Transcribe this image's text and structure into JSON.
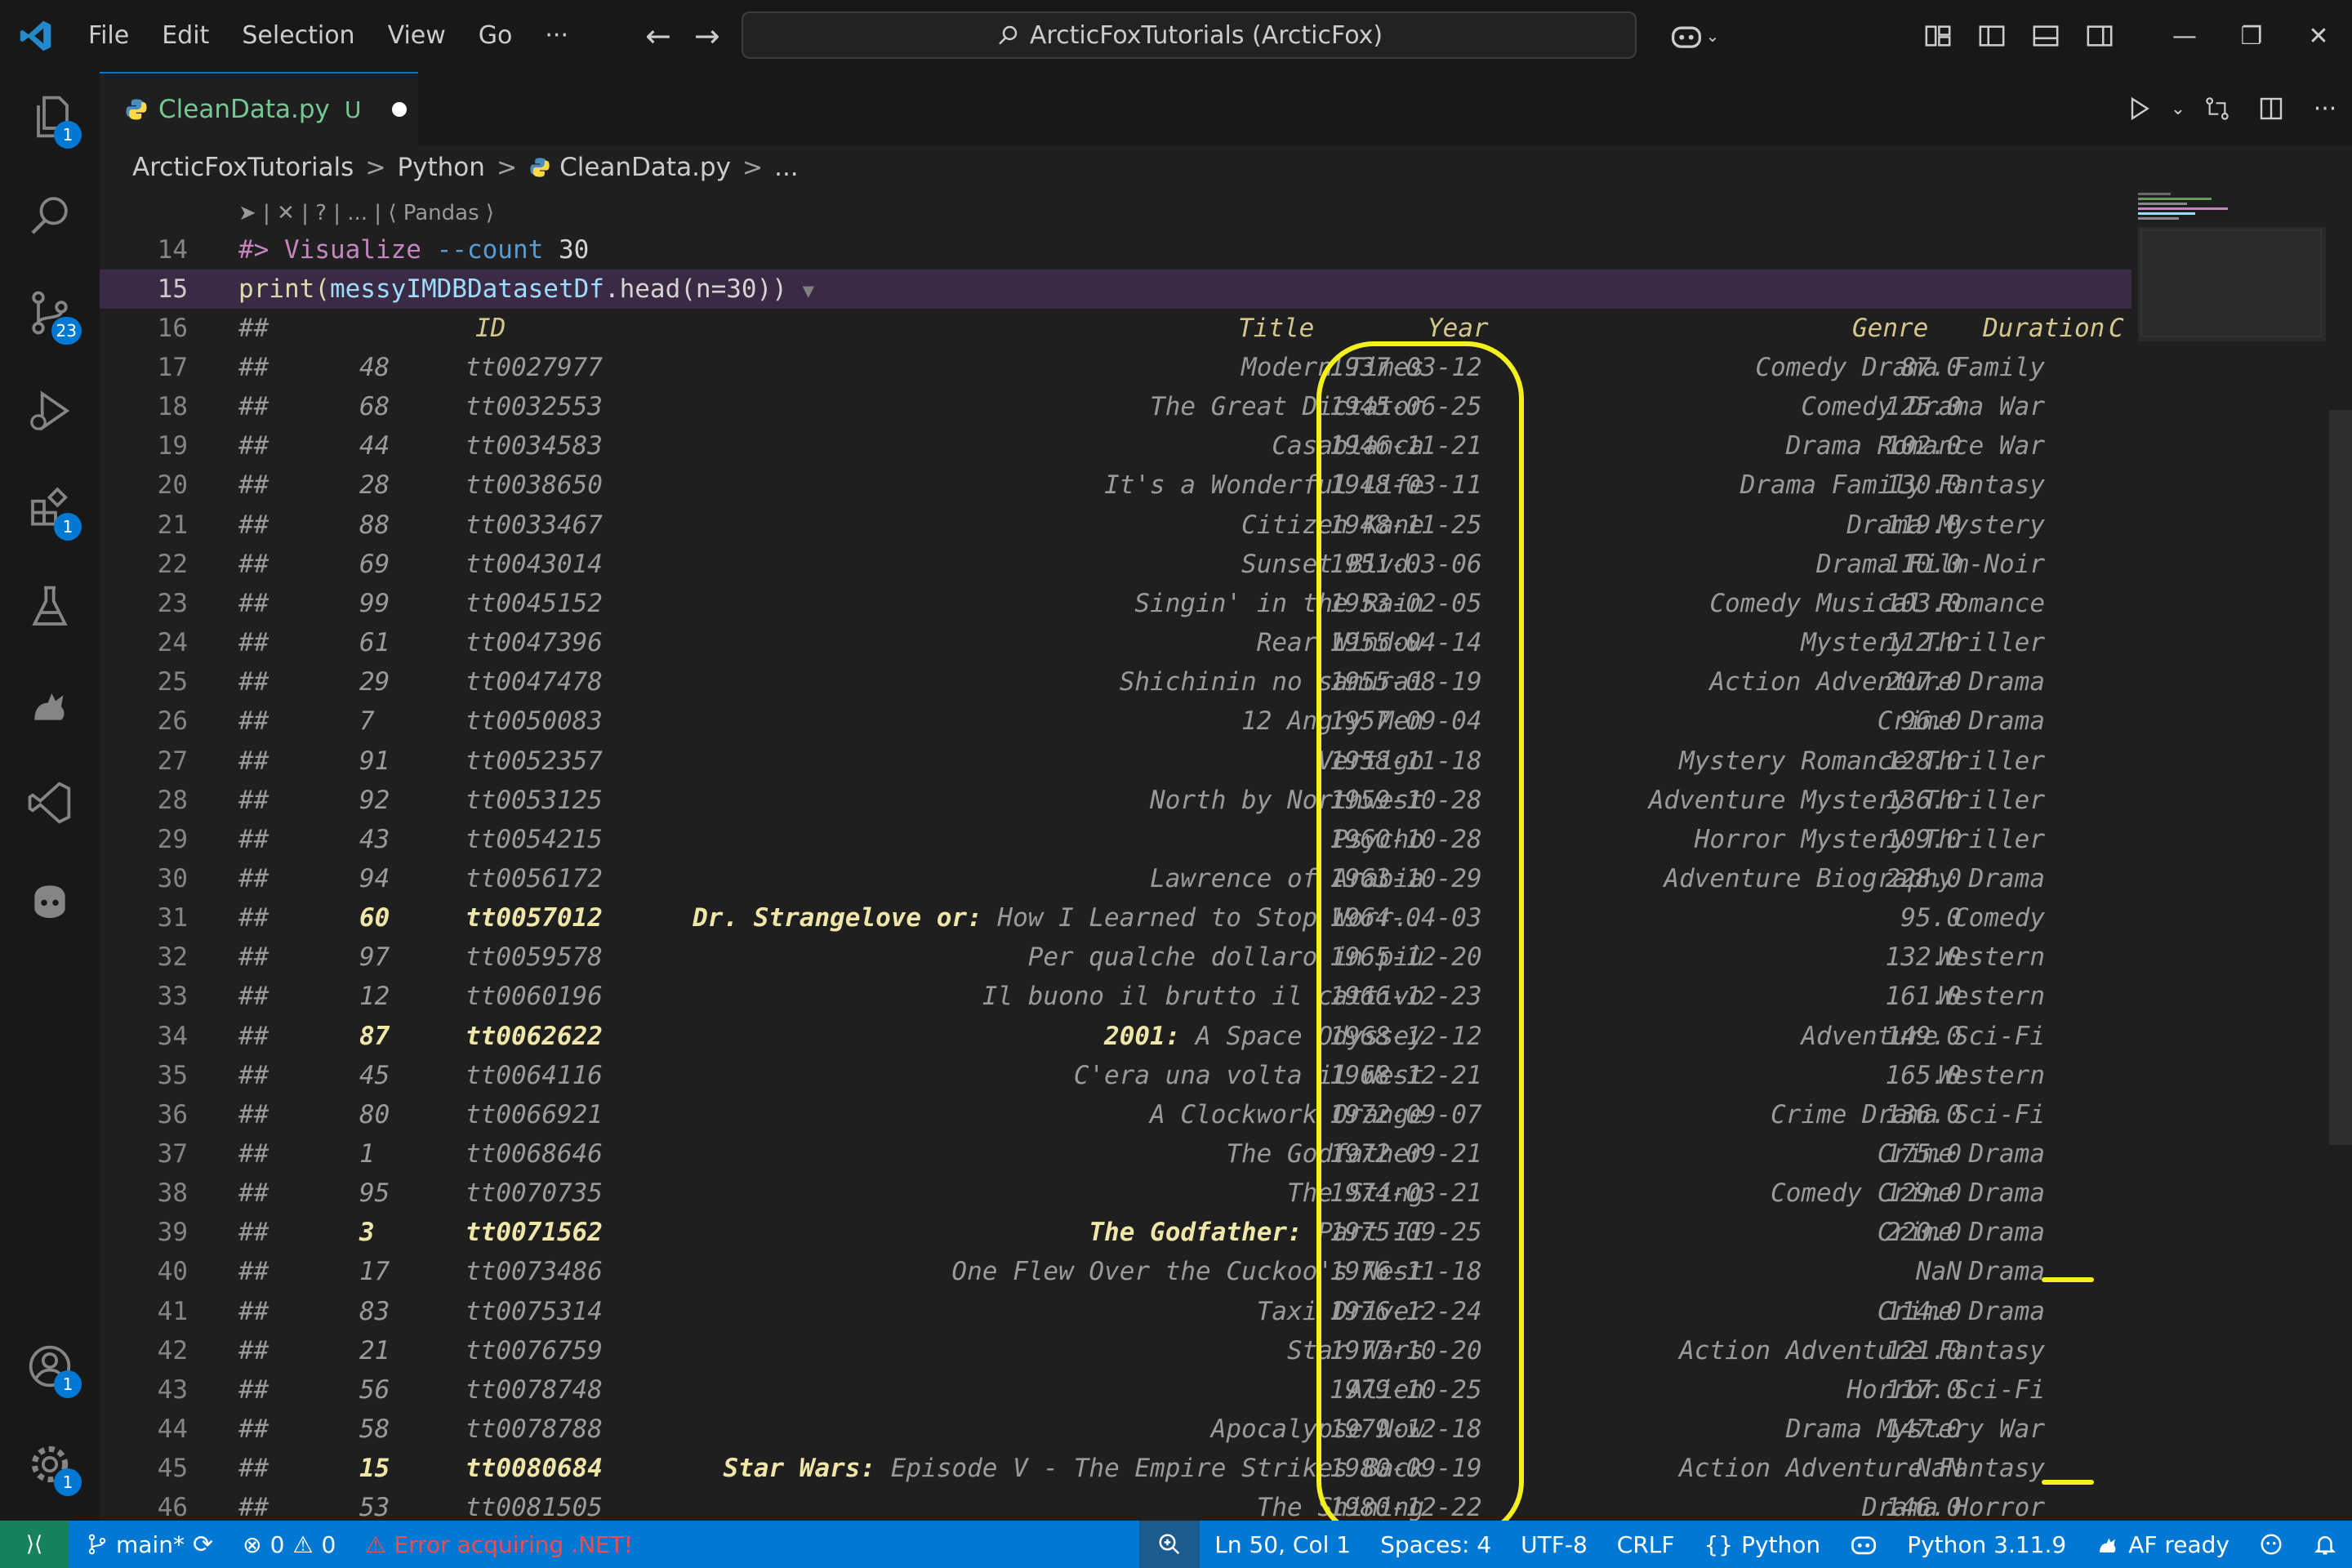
{
  "menu": {
    "items": [
      "File",
      "Edit",
      "Selection",
      "View",
      "Go"
    ],
    "more": "···"
  },
  "command_center": {
    "text": "ArcticFoxTutorials (ArcticFox)"
  },
  "activity_badges": {
    "explorer": "1",
    "source_control": "23",
    "extensions": "1",
    "accounts": "1",
    "manage": "1"
  },
  "tab": {
    "name": "CleanData.py",
    "status": "U"
  },
  "breadcrumb": {
    "folder1": "ArcticFoxTutorials",
    "folder2": "Python",
    "file": "CleanData.py",
    "more": "..."
  },
  "codelens": "➤ | ✕ | ? | ... | ⟨ Pandas ⟩",
  "editor": {
    "line14": {
      "num": "14",
      "hash": "#>",
      "cmd": " Visualize",
      "flag": " --count",
      "arg": " 30"
    },
    "line15": {
      "num": "15",
      "text_pre": "print(",
      "ident": "messyIMDBDatasetDf",
      "text_post": ".head(n=30))",
      "fold": "▼"
    },
    "header": {
      "num": "16",
      "hash": "##",
      "id": "ID",
      "title": "Title",
      "year": "Year",
      "genre": "Genre",
      "duration": "Duration",
      "cut": "C"
    },
    "rows": [
      {
        "num": "17",
        "idx": "48",
        "id": "tt0027977",
        "title": "Modern Times",
        "year": "1937-03-12",
        "genre": "Comedy Drama Family",
        "dur": "87.0"
      },
      {
        "num": "18",
        "idx": "68",
        "id": "tt0032553",
        "title": "The Great Dictator",
        "year": "1945-06-25",
        "genre": "Comedy Drama War",
        "dur": "125.0"
      },
      {
        "num": "19",
        "idx": "44",
        "id": "tt0034583",
        "title": "Casablanca",
        "year": "1946-11-21",
        "genre": "Drama Romance War",
        "dur": "102.0"
      },
      {
        "num": "20",
        "idx": "28",
        "id": "tt0038650",
        "title": "It's a Wonderful Life",
        "year": "1948-03-11",
        "genre": "Drama Family Fantasy",
        "dur": "130.0"
      },
      {
        "num": "21",
        "idx": "88",
        "id": "tt0033467",
        "title": "Citizen Kane",
        "year": "1948-11-25",
        "genre": "Drama Mystery",
        "dur": "119.0"
      },
      {
        "num": "22",
        "idx": "69",
        "id": "tt0043014",
        "title": "Sunset Blvd.",
        "year": "1951-03-06",
        "genre": "Drama Film-Noir",
        "dur": "110.0"
      },
      {
        "num": "23",
        "idx": "99",
        "id": "tt0045152",
        "title": "Singin' in the Rain",
        "year": "1953-02-05",
        "genre": "Comedy Musical Romance",
        "dur": "103.0"
      },
      {
        "num": "24",
        "idx": "61",
        "id": "tt0047396",
        "title": "Rear Window",
        "year": "1955-04-14",
        "genre": "Mystery Thriller",
        "dur": "112.0"
      },
      {
        "num": "25",
        "idx": "29",
        "id": "tt0047478",
        "title": "Shichinin no samurai",
        "year": "1955-08-19",
        "genre": "Action Adventure Drama",
        "dur": "207.0"
      },
      {
        "num": "26",
        "idx": "7",
        "id": "tt0050083",
        "title": "12 Angry Men",
        "year": "1957-09-04",
        "genre": "Crime Drama",
        "dur": "96.0"
      },
      {
        "num": "27",
        "idx": "91",
        "id": "tt0052357",
        "title": "Vertigo",
        "year": "1958-11-18",
        "genre": "Mystery Romance Thriller",
        "dur": "128.0"
      },
      {
        "num": "28",
        "idx": "92",
        "id": "tt0053125",
        "title": "North by Northwest",
        "year": "1959-10-28",
        "genre": "Adventure Mystery Thriller",
        "dur": "136.0"
      },
      {
        "num": "29",
        "idx": "43",
        "id": "tt0054215",
        "title": "Psycho",
        "year": "1960-10-28",
        "genre": "Horror Mystery Thriller",
        "dur": "109.0"
      },
      {
        "num": "30",
        "idx": "94",
        "id": "tt0056172",
        "title": "Lawrence of Arabia",
        "year": "1963-10-29",
        "genre": "Adventure Biography Drama",
        "dur": "228.0"
      },
      {
        "num": "31",
        "idx": "60",
        "id": "tt0057012",
        "title_bold": "Dr. Strangelove or:",
        "title": " How I Learned to Stop Worr..",
        "year": "1964-04-03",
        "genre": "Comedy",
        "dur": "95.0",
        "bold": true
      },
      {
        "num": "32",
        "idx": "97",
        "id": "tt0059578",
        "title": "Per qualche dollaro in più",
        "year": "1965-12-20",
        "genre": "Western",
        "dur": "132.0"
      },
      {
        "num": "33",
        "idx": "12",
        "id": "tt0060196",
        "title": "Il buono il brutto il cattivo",
        "year": "1966-12-23",
        "genre": "Western",
        "dur": "161.0"
      },
      {
        "num": "34",
        "idx": "87",
        "id": "tt0062622",
        "title_bold": "2001:",
        "title": " A Space Odyssey",
        "year": "1968-12-12",
        "genre": "Adventure Sci-Fi",
        "dur": "149.0",
        "bold": true
      },
      {
        "num": "35",
        "idx": "45",
        "id": "tt0064116",
        "title": "C'era una volta il West",
        "year": "1968-12-21",
        "genre": "Western",
        "dur": "165.0"
      },
      {
        "num": "36",
        "idx": "80",
        "id": "tt0066921",
        "title": "A Clockwork Orange",
        "year": "1972-09-07",
        "genre": "Crime Drama Sci-Fi",
        "dur": "136.0"
      },
      {
        "num": "37",
        "idx": "1",
        "id": "tt0068646",
        "title": "The Godfather",
        "year": "1972-09-21",
        "genre": "Crime Drama",
        "dur": "175.0"
      },
      {
        "num": "38",
        "idx": "95",
        "id": "tt0070735",
        "title": "The Sting",
        "year": "1974-03-21",
        "genre": "Comedy Crime Drama",
        "dur": "129.0"
      },
      {
        "num": "39",
        "idx": "3",
        "id": "tt0071562",
        "title_bold": "The Godfather:",
        "title": " Part II",
        "year": "1975-09-25",
        "genre": "Crime Drama",
        "dur": "220.0",
        "bold": true
      },
      {
        "num": "40",
        "idx": "17",
        "id": "tt0073486",
        "title": "One Flew Over the Cuckoo's Nest",
        "year": "1976-11-18",
        "genre": "Drama",
        "dur": "NaN"
      },
      {
        "num": "41",
        "idx": "83",
        "id": "tt0075314",
        "title": "Taxi Driver",
        "year": "1976-12-24",
        "genre": "Crime Drama",
        "dur": "114.0"
      },
      {
        "num": "42",
        "idx": "21",
        "id": "tt0076759",
        "title": "Star Wars",
        "year": "1977-10-20",
        "genre": "Action Adventure Fantasy",
        "dur": "121.0"
      },
      {
        "num": "43",
        "idx": "56",
        "id": "tt0078748",
        "title": "Alien",
        "year": "1979-10-25",
        "genre": "Horror Sci-Fi",
        "dur": "117.0"
      },
      {
        "num": "44",
        "idx": "58",
        "id": "tt0078788",
        "title": "Apocalypse Now",
        "year": "1979-12-18",
        "genre": "Drama Mystery War",
        "dur": "147.0"
      },
      {
        "num": "45",
        "idx": "15",
        "id": "tt0080684",
        "title_bold": "Star Wars:",
        "title": " Episode V - The Empire Strikes Back",
        "year": "1980-09-19",
        "genre": "Action Adventure Fantasy",
        "dur": "NaN",
        "bold": true
      },
      {
        "num": "46",
        "idx": "53",
        "id": "tt0081505",
        "title": "The Shining",
        "year": "1980-12-22",
        "genre": "Drama Horror",
        "dur": "146.0"
      }
    ]
  },
  "statusbar": {
    "branch": "main*",
    "errors": "0",
    "warnings": "0",
    "dotnet": "Error acquiring .NET!",
    "position": "Ln 50, Col 1",
    "spaces": "Spaces: 4",
    "encoding": "UTF-8",
    "eol": "CRLF",
    "language": "Python",
    "interpreter": "Python 3.11.9",
    "af": "AF ready"
  },
  "colors": {
    "accent": "#0078d4",
    "highlight": "#f4f01c",
    "untracked": "#73c991",
    "error": "#f14c4c"
  }
}
